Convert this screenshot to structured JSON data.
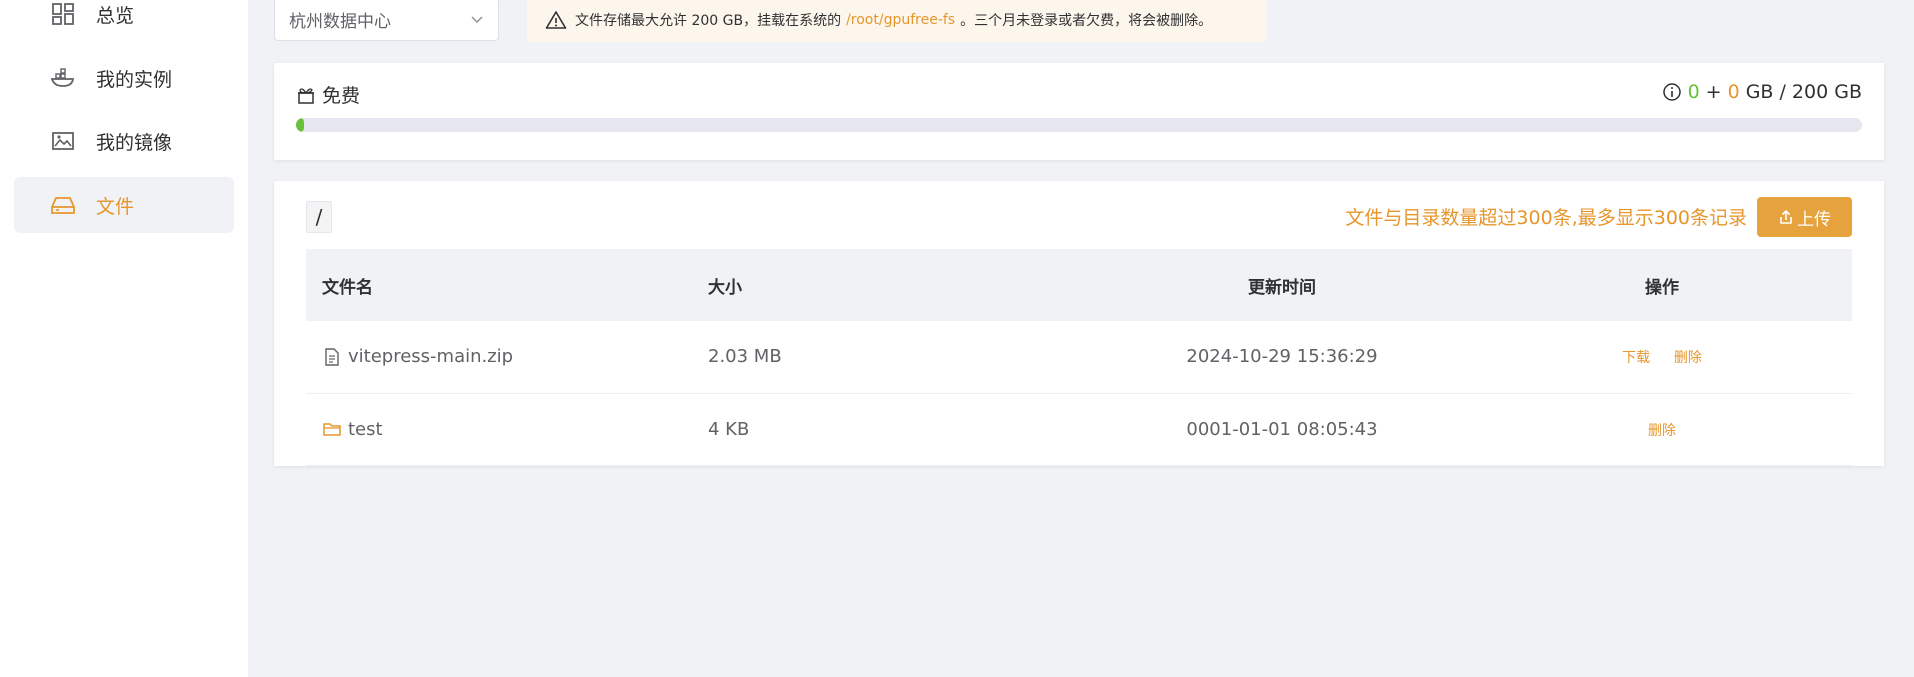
{
  "sidebar": {
    "items": [
      {
        "label": "总览",
        "icon": "dashboard-icon"
      },
      {
        "label": "我的实例",
        "icon": "container-icon"
      },
      {
        "label": "我的镜像",
        "icon": "image-icon"
      },
      {
        "label": "文件",
        "icon": "drive-icon",
        "active": true
      }
    ]
  },
  "region": {
    "selected": "杭州数据中心"
  },
  "notice": {
    "text_before": "文件存储最大允许 200 GB，挂载在系统的",
    "path": "/root/gpufree-fs",
    "text_after": "。三个月未登录或者欠费，将会被删除。"
  },
  "storage": {
    "title": "免费",
    "used_a": "0",
    "plus": "+",
    "used_b": "0",
    "unit_total": "GB / 200 GB",
    "used_fraction": 0.004
  },
  "files": {
    "path": "/",
    "limit_note": "文件与目录数量超过300条,最多显示300条记录",
    "upload_label": "上传",
    "columns": {
      "name": "文件名",
      "size": "大小",
      "time": "更新时间",
      "ops": "操作"
    },
    "rows": [
      {
        "name": "vitepress-main.zip",
        "type": "file",
        "size": "2.03 MB",
        "time": "2024-10-29 15:36:29",
        "download": "下载",
        "delete": "删除"
      },
      {
        "name": "test",
        "type": "folder",
        "size": "4 KB",
        "time": "0001-01-01 08:05:43",
        "delete": "删除"
      }
    ]
  },
  "colors": {
    "accent": "#e6962c",
    "green": "#67c23a"
  }
}
